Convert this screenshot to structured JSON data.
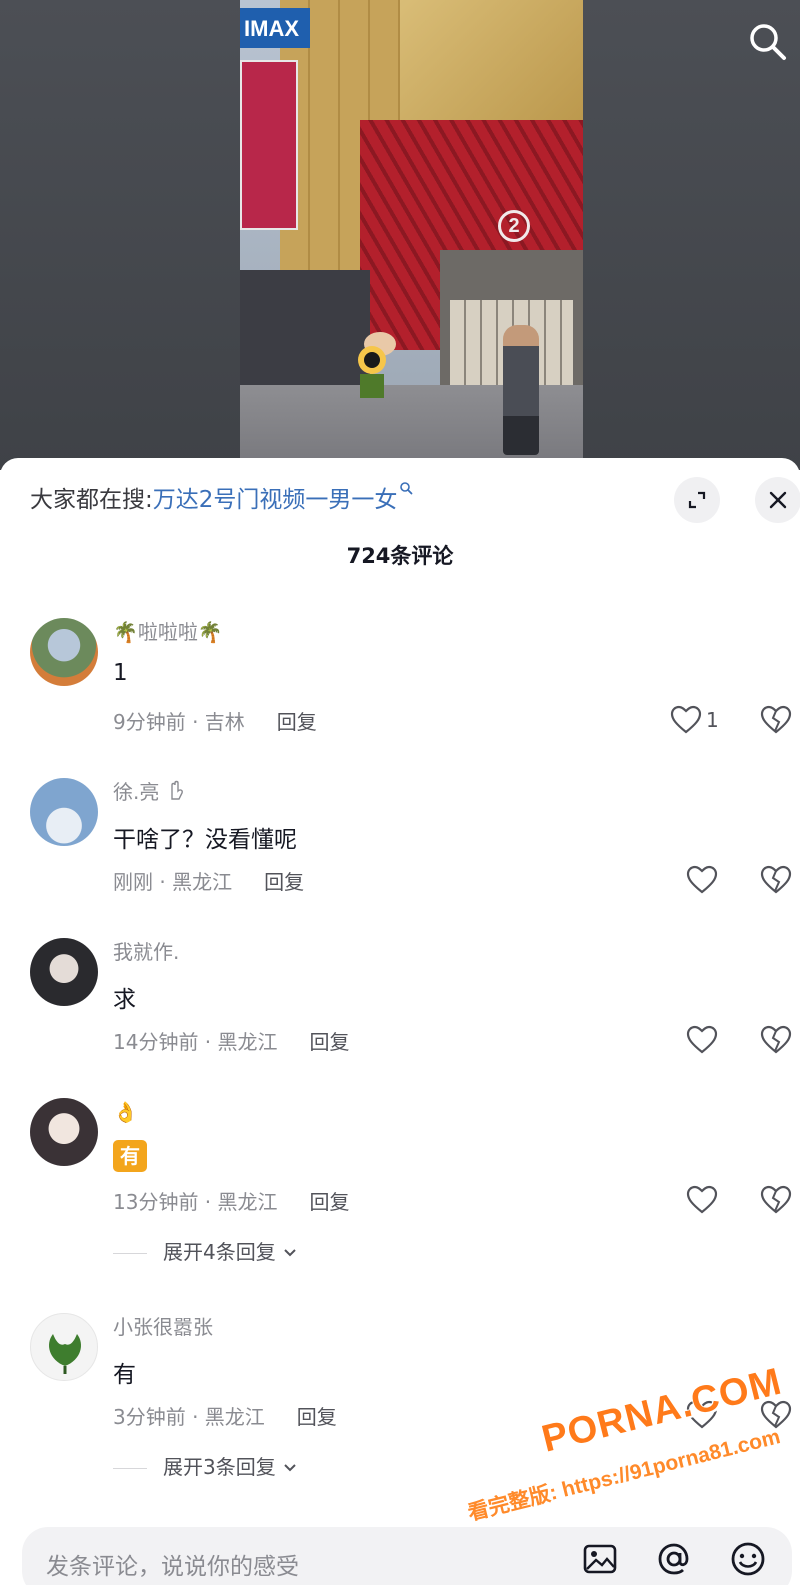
{
  "video": {
    "sign_text": "IMAX",
    "door_number": "2"
  },
  "search_suggestion": {
    "prefix": "大家都在搜:",
    "term": "万达2号门视频一男一女"
  },
  "comment_count": "724条评论",
  "comments": [
    {
      "username": "🌴啦啦啦🌴",
      "text": "1",
      "time_location": "9分钟前 · 吉林",
      "reply_label": "回复",
      "likes": "1"
    },
    {
      "username": "徐.亮",
      "text": "干啥了？没看懂呢",
      "time_location": "刚刚 · 黑龙江",
      "reply_label": "回复",
      "likes": ""
    },
    {
      "username": "我就作.",
      "text": "求",
      "time_location": "14分钟前 · 黑龙江",
      "reply_label": "回复",
      "likes": ""
    },
    {
      "username": "👌",
      "text": "有",
      "time_location": "13分钟前 · 黑龙江",
      "reply_label": "回复",
      "likes": "",
      "expand_replies": "展开4条回复"
    },
    {
      "username": "小张很嚣张",
      "text": "有",
      "time_location": "3分钟前 · 黑龙江",
      "reply_label": "回复",
      "likes": "",
      "expand_replies": "展开3条回复"
    }
  ],
  "input": {
    "placeholder": "发条评论，说说你的感受"
  },
  "watermark": {
    "main": "PORNA.COM",
    "sub": "看完整版: https://91porna81.com"
  },
  "colors": {
    "search_term": "#3a6fb8",
    "badge": "#f3a51c",
    "watermark": "#ff7a1a"
  }
}
